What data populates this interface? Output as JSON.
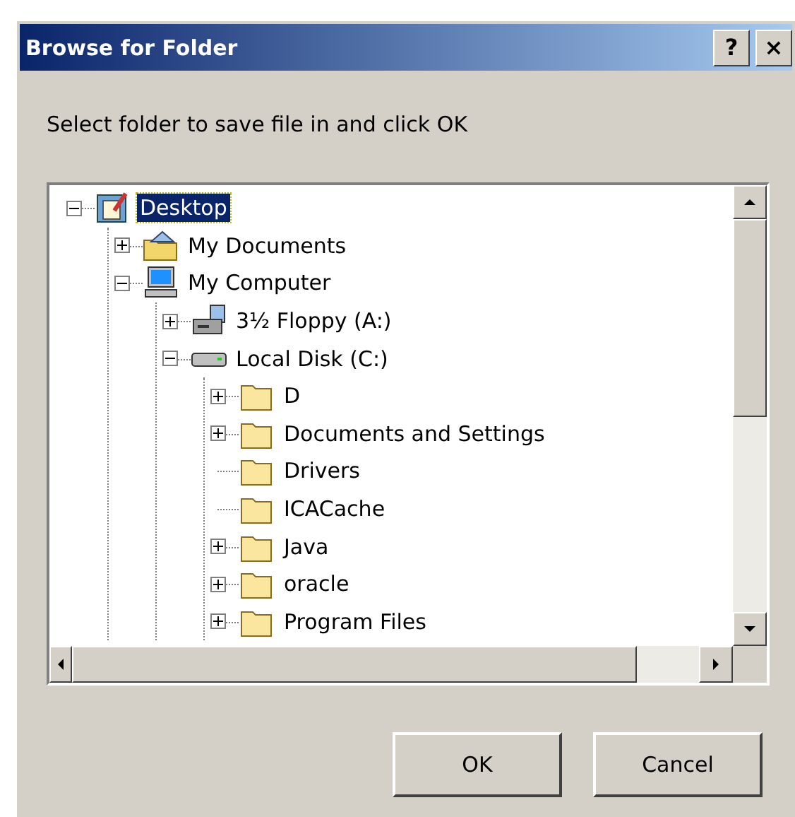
{
  "window": {
    "title": "Browse for Folder",
    "title_buttons": [
      "?",
      "×"
    ]
  },
  "prompt": "Select folder to save file in and click OK",
  "tree": [
    {
      "label": "Desktop",
      "kind": "desktop",
      "expanded": true,
      "selected": true,
      "children": [
        {
          "label": "My Documents",
          "kind": "documents",
          "expanded": false,
          "selected": false
        },
        {
          "label": "My Computer",
          "kind": "computer",
          "expanded": true,
          "selected": false,
          "children": [
            {
              "label": "3½ Floppy (A:)",
              "kind": "floppy",
              "expanded": false,
              "selected": false
            },
            {
              "label": "Local Disk (C:)",
              "kind": "disk",
              "expanded": true,
              "selected": false,
              "children": [
                {
                  "label": "D",
                  "kind": "folder",
                  "expanded": false,
                  "selected": false
                },
                {
                  "label": "Documents and Settings",
                  "kind": "folder",
                  "expanded": false,
                  "selected": false
                },
                {
                  "label": "Drivers",
                  "kind": "folder",
                  "selected": false
                },
                {
                  "label": "ICACache",
                  "kind": "folder",
                  "selected": false
                },
                {
                  "label": "Java",
                  "kind": "folder",
                  "expanded": false,
                  "selected": false
                },
                {
                  "label": "oracle",
                  "kind": "folder",
                  "expanded": false,
                  "selected": false
                },
                {
                  "label": "Program Files",
                  "kind": "folder",
                  "expanded": false,
                  "selected": false
                }
              ]
            }
          ]
        }
      ]
    }
  ],
  "buttons": [
    "OK",
    "Cancel"
  ]
}
